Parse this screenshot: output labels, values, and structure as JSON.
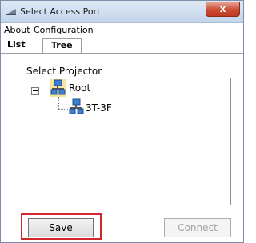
{
  "window": {
    "title": "Select Access Port",
    "close_glyph": "x"
  },
  "menu": {
    "items": [
      "About",
      "Configuration"
    ]
  },
  "tabs": [
    {
      "label": "List"
    },
    {
      "label": "Tree",
      "active": true
    }
  ],
  "section": {
    "label": "Select Projector"
  },
  "tree": {
    "root": {
      "label": "Root",
      "expander": "minus",
      "icon": "network-icon"
    },
    "children": [
      {
        "label": "3T-3F",
        "icon": "network-icon"
      }
    ]
  },
  "buttons": {
    "save": "Save",
    "connect": "Connect"
  },
  "colors": {
    "highlight_border": "#d0272b",
    "close_button": "#c94a33",
    "disabled_text": "#a3a3a3"
  }
}
